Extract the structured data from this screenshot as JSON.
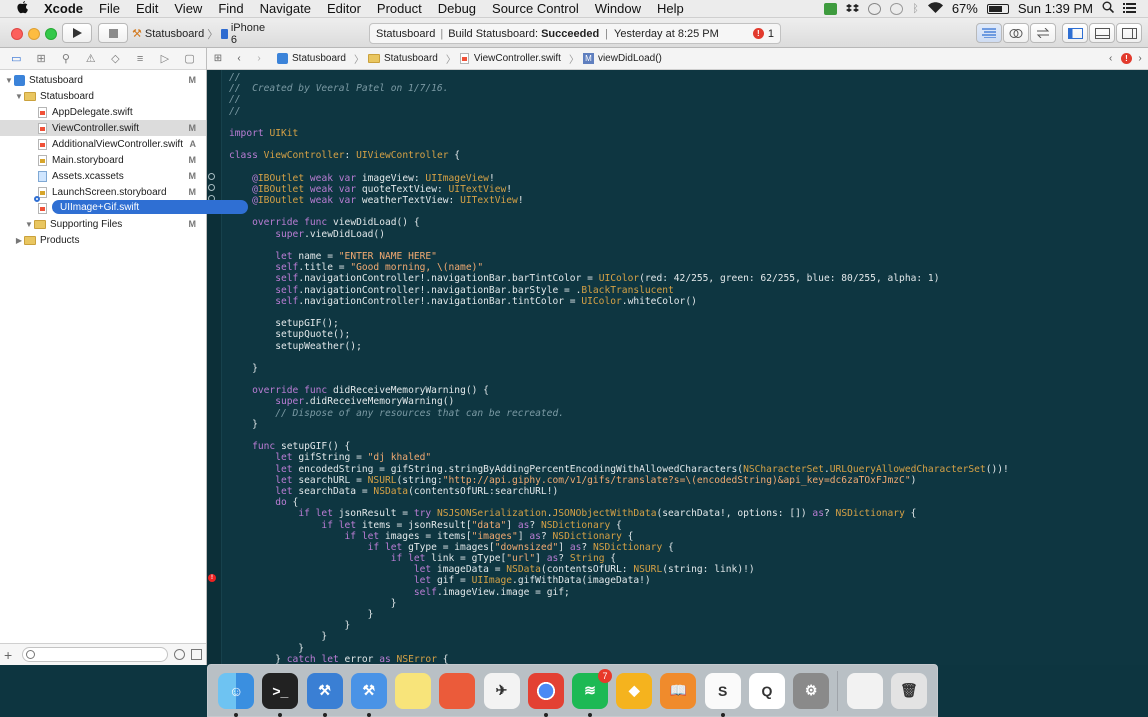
{
  "menubar": {
    "app": "Xcode",
    "items": [
      "File",
      "Edit",
      "View",
      "Find",
      "Navigate",
      "Editor",
      "Product",
      "Debug",
      "Source Control",
      "Window",
      "Help"
    ],
    "battery": "67%",
    "clock": "Sun 1:39 PM"
  },
  "toolbar": {
    "scheme": "Statusboard",
    "device": "iPhone 6",
    "activity_project": "Statusboard",
    "activity_sep": "|",
    "activity_build": "Build Statusboard:",
    "activity_status": "Succeeded",
    "activity_time": "Yesterday at 8:25 PM",
    "error_count": "1"
  },
  "navigator": {
    "tree": [
      {
        "label": "Statusboard",
        "badge": "M"
      },
      {
        "label": "Statusboard",
        "badge": ""
      },
      {
        "label": "AppDelegate.swift",
        "badge": ""
      },
      {
        "label": "ViewController.swift",
        "badge": "M"
      },
      {
        "label": "AdditionalViewController.swift",
        "badge": "A"
      },
      {
        "label": "Main.storyboard",
        "badge": "M"
      },
      {
        "label": "Assets.xcassets",
        "badge": "M"
      },
      {
        "label": "LaunchScreen.storyboard",
        "badge": "M"
      },
      {
        "label": "I",
        "badge": ""
      },
      {
        "label": "Supporting Files",
        "badge": "M"
      },
      {
        "label": "Products",
        "badge": ""
      }
    ],
    "drag_label": "UIImage+Gif.swift"
  },
  "jumpbar": {
    "crumbs": [
      "Statusboard",
      "Statusboard",
      "ViewController.swift",
      "viewDidLoad()"
    ]
  },
  "code_lines": [
    "//",
    "//  Created by Veeral Patel on 1/7/16.",
    "//",
    "//",
    "",
    "import UIKit",
    "",
    "class ViewController: UIViewController {",
    "",
    "    @IBOutlet weak var imageView: UIImageView!",
    "    @IBOutlet weak var quoteTextView: UITextView!",
    "    @IBOutlet weak var weatherTextView: UITextView!",
    "",
    "    override func viewDidLoad() {",
    "        super.viewDidLoad()",
    "",
    "        let name = \"ENTER NAME HERE\"",
    "        self.title = \"Good morning, \\(name)\"",
    "        self.navigationController!.navigationBar.barTintColor = UIColor(red: 42/255, green: 62/255, blue: 80/255, alpha: 1)",
    "        self.navigationController!.navigationBar.barStyle = .BlackTranslucent",
    "        self.navigationController!.navigationBar.tintColor = UIColor.whiteColor()",
    "",
    "        setupGIF();",
    "        setupQuote();",
    "        setupWeather();",
    "",
    "    }",
    "",
    "    override func didReceiveMemoryWarning() {",
    "        super.didReceiveMemoryWarning()",
    "        // Dispose of any resources that can be recreated.",
    "    }",
    "",
    "    func setupGIF() {",
    "        let gifString = \"dj khaled\"",
    "        let encodedString = gifString.stringByAddingPercentEncodingWithAllowedCharacters(NSCharacterSet.URLQueryAllowedCharacterSet())!",
    "        let searchURL = NSURL(string:\"http://api.giphy.com/v1/gifs/translate?s=\\(encodedString)&api_key=dc6zaTOxFJmzC\")",
    "        let searchData = NSData(contentsOfURL:searchURL!)",
    "        do {",
    "            if let jsonResult = try NSJSONSerialization.JSONObjectWithData(searchData!, options: []) as? NSDictionary {",
    "                if let items = jsonResult[\"data\"] as? NSDictionary {",
    "                    if let images = items[\"images\"] as? NSDictionary {",
    "                        if let gType = images[\"downsized\"] as? NSDictionary {",
    "                            if let link = gType[\"url\"] as? String {",
    "                                let imageData = NSData(contentsOfURL: NSURL(string: link)!)",
    "                                let gif = UIImage.gifWithData(imageData!)",
    "                                self.imageView.image = gif;",
    "                            }",
    "                        }",
    "                    }",
    "                }",
    "            }",
    "        } catch let error as NSError {"
  ],
  "dock": {
    "apps": [
      {
        "name": "finder",
        "glyph": "☺"
      },
      {
        "name": "terminal",
        "glyph": ">_"
      },
      {
        "name": "xcode",
        "glyph": "⚒"
      },
      {
        "name": "xcode-beta",
        "glyph": "⚒"
      },
      {
        "name": "notes",
        "glyph": ""
      },
      {
        "name": "rdio",
        "glyph": ""
      },
      {
        "name": "airmail",
        "glyph": "✈"
      },
      {
        "name": "chrome",
        "glyph": ""
      },
      {
        "name": "spotify",
        "glyph": "≋",
        "badge": "7"
      },
      {
        "name": "sketch",
        "glyph": "◆"
      },
      {
        "name": "ibooks",
        "glyph": "📖"
      },
      {
        "name": "slack",
        "glyph": "S"
      },
      {
        "name": "quicktime",
        "glyph": "Q"
      },
      {
        "name": "system-preferences",
        "glyph": "⚙"
      },
      {
        "name": "downloads-stack",
        "glyph": ""
      },
      {
        "name": "trash",
        "glyph": "🗑"
      }
    ]
  },
  "colors": {
    "editor_bg": "#0e3641",
    "keyword": "#ba7dd4",
    "type": "#d5a146",
    "string": "#f1aa72",
    "comment": "#7b9aa4",
    "accent": "#2f6fd3"
  }
}
